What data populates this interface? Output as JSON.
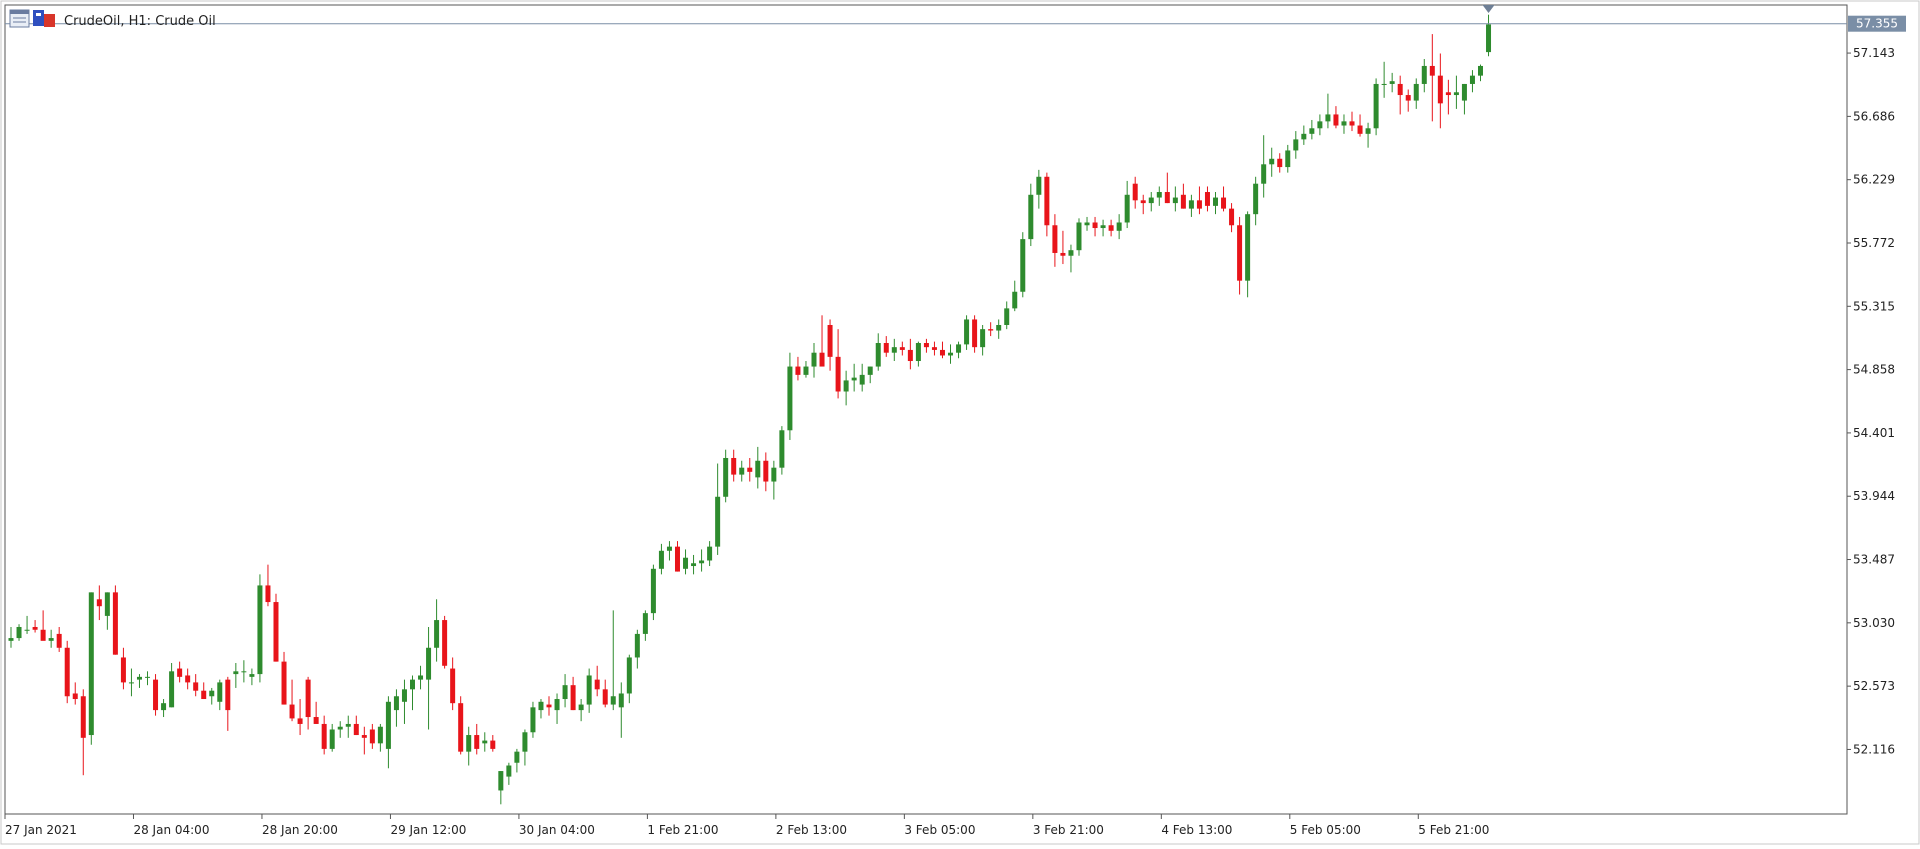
{
  "header": {
    "symbol_label": "CrudeOil, H1:  Crude Oil",
    "icon_names": [
      "chart-window-icon",
      "symbol-flag-icon"
    ]
  },
  "current_price": "57.355",
  "colors": {
    "bull": "#2e8b2e",
    "bear": "#e8141a",
    "axis": "#555555",
    "price_tag_bg": "#7a8ea6",
    "price_line": "#7a8ea6"
  },
  "chart_data": {
    "type": "candlestick",
    "title": "CrudeOil, H1:  Crude Oil",
    "xlabel": "",
    "ylabel": "",
    "ylim": [
      51.65,
      57.49
    ],
    "y_ticks": [
      57.143,
      56.686,
      56.229,
      55.772,
      55.315,
      54.858,
      54.401,
      53.944,
      53.487,
      53.03,
      52.573,
      52.116
    ],
    "y_tick_labels": [
      "57.143",
      "56.686",
      "56.229",
      "55.772",
      "55.315",
      "54.858",
      "54.401",
      "53.944",
      "53.487",
      "53.030",
      "52.573",
      "52.116"
    ],
    "x_ticks": [
      {
        "bar": 0,
        "label": "27 Jan 2021"
      },
      {
        "bar": 16,
        "label": "28 Jan 04:00"
      },
      {
        "bar": 32,
        "label": "28 Jan 20:00"
      },
      {
        "bar": 48,
        "label": "29 Jan 12:00"
      },
      {
        "bar": 64,
        "label": "30 Jan 04:00"
      },
      {
        "bar": 80,
        "label": "1 Feb 21:00"
      },
      {
        "bar": 96,
        "label": "2 Feb 13:00"
      },
      {
        "bar": 112,
        "label": "3 Feb 05:00"
      },
      {
        "bar": 128,
        "label": "3 Feb 21:00"
      },
      {
        "bar": 144,
        "label": "4 Feb 13:00"
      },
      {
        "bar": 160,
        "label": "5 Feb 05:00"
      },
      {
        "bar": 176,
        "label": "5 Feb 21:00"
      }
    ],
    "grid": false,
    "candles": [
      [
        52.9,
        53.0,
        52.85,
        52.92
      ],
      [
        52.92,
        53.02,
        52.9,
        53.0
      ],
      [
        52.98,
        53.08,
        52.95,
        52.98
      ],
      [
        53.0,
        53.05,
        52.96,
        52.98
      ],
      [
        52.98,
        53.12,
        52.92,
        52.9
      ],
      [
        52.9,
        52.98,
        52.85,
        52.92
      ],
      [
        52.95,
        53.0,
        52.82,
        52.85
      ],
      [
        52.85,
        52.9,
        52.45,
        52.5
      ],
      [
        52.52,
        52.6,
        52.44,
        52.48
      ],
      [
        52.5,
        52.55,
        51.93,
        52.2
      ],
      [
        52.22,
        53.25,
        52.15,
        53.25
      ],
      [
        53.2,
        53.3,
        53.05,
        53.15
      ],
      [
        53.08,
        53.25,
        52.98,
        53.25
      ],
      [
        53.25,
        53.3,
        52.8,
        52.8
      ],
      [
        52.78,
        52.85,
        52.55,
        52.6
      ],
      [
        52.6,
        52.7,
        52.5,
        52.6
      ],
      [
        52.62,
        52.66,
        52.56,
        52.64
      ],
      [
        52.64,
        52.68,
        52.58,
        52.64
      ],
      [
        52.62,
        52.66,
        52.36,
        52.4
      ],
      [
        52.4,
        52.48,
        52.35,
        52.45
      ],
      [
        52.42,
        52.74,
        52.42,
        52.68
      ],
      [
        52.7,
        52.75,
        52.6,
        52.64
      ],
      [
        52.65,
        52.7,
        52.55,
        52.6
      ],
      [
        52.6,
        52.66,
        52.5,
        52.54
      ],
      [
        52.54,
        52.6,
        52.48,
        52.48
      ],
      [
        52.5,
        52.56,
        52.44,
        52.54
      ],
      [
        52.46,
        52.62,
        52.4,
        52.6
      ],
      [
        52.62,
        52.64,
        52.25,
        52.4
      ],
      [
        52.66,
        52.74,
        52.56,
        52.68
      ],
      [
        52.68,
        52.76,
        52.6,
        52.68
      ],
      [
        52.64,
        52.7,
        52.58,
        52.66
      ],
      [
        52.66,
        53.38,
        52.6,
        53.3
      ],
      [
        53.3,
        53.45,
        53.15,
        53.18
      ],
      [
        53.18,
        53.24,
        52.75,
        52.75
      ],
      [
        52.75,
        52.82,
        52.44,
        52.44
      ],
      [
        52.44,
        52.62,
        52.32,
        52.34
      ],
      [
        52.34,
        52.48,
        52.22,
        52.3
      ],
      [
        52.62,
        52.64,
        52.26,
        52.35
      ],
      [
        52.35,
        52.46,
        52.3,
        52.3
      ],
      [
        52.3,
        52.36,
        52.08,
        52.12
      ],
      [
        52.12,
        52.3,
        52.1,
        52.26
      ],
      [
        52.26,
        52.32,
        52.2,
        52.28
      ],
      [
        52.28,
        52.36,
        52.2,
        52.3
      ],
      [
        52.3,
        52.36,
        52.22,
        52.22
      ],
      [
        52.22,
        52.28,
        52.08,
        52.2
      ],
      [
        52.26,
        52.3,
        52.12,
        52.16
      ],
      [
        52.16,
        52.3,
        52.1,
        52.28
      ],
      [
        52.12,
        52.5,
        51.98,
        52.46
      ],
      [
        52.4,
        52.55,
        52.28,
        52.5
      ],
      [
        52.46,
        52.62,
        52.3,
        52.55
      ],
      [
        52.55,
        52.65,
        52.4,
        52.62
      ],
      [
        52.62,
        52.72,
        52.55,
        52.65
      ],
      [
        52.62,
        53.0,
        52.26,
        52.85
      ],
      [
        52.85,
        53.2,
        52.75,
        53.05
      ],
      [
        53.05,
        53.08,
        52.7,
        52.72
      ],
      [
        52.7,
        52.78,
        52.4,
        52.45
      ],
      [
        52.45,
        52.5,
        52.08,
        52.1
      ],
      [
        52.1,
        52.28,
        52.0,
        52.22
      ],
      [
        52.22,
        52.3,
        52.08,
        52.12
      ],
      [
        52.16,
        52.24,
        52.1,
        52.18
      ],
      [
        52.18,
        52.22,
        52.1,
        52.12
      ],
      [
        51.82,
        51.96,
        51.72,
        51.96
      ],
      [
        51.92,
        52.02,
        51.86,
        52.0
      ],
      [
        52.02,
        52.12,
        51.95,
        52.1
      ],
      [
        52.1,
        52.26,
        52.0,
        52.24
      ],
      [
        52.24,
        52.46,
        52.2,
        52.42
      ],
      [
        52.4,
        52.48,
        52.34,
        52.46
      ],
      [
        52.44,
        52.5,
        52.36,
        52.42
      ],
      [
        52.4,
        52.52,
        52.3,
        52.48
      ],
      [
        52.48,
        52.66,
        52.42,
        52.58
      ],
      [
        52.58,
        52.64,
        52.4,
        52.4
      ],
      [
        52.4,
        52.48,
        52.32,
        52.44
      ],
      [
        52.44,
        52.7,
        52.38,
        52.65
      ],
      [
        52.62,
        52.72,
        52.5,
        52.55
      ],
      [
        52.55,
        52.62,
        52.42,
        52.44
      ],
      [
        52.44,
        53.12,
        52.4,
        52.5
      ],
      [
        52.42,
        52.6,
        52.2,
        52.52
      ],
      [
        52.52,
        52.8,
        52.45,
        52.78
      ],
      [
        52.78,
        52.98,
        52.7,
        52.95
      ],
      [
        52.95,
        53.12,
        52.9,
        53.1
      ],
      [
        53.1,
        53.45,
        53.05,
        53.42
      ],
      [
        53.42,
        53.6,
        53.38,
        53.55
      ],
      [
        53.55,
        53.62,
        53.48,
        53.58
      ],
      [
        53.58,
        53.62,
        53.4,
        53.4
      ],
      [
        53.42,
        53.56,
        53.38,
        53.5
      ],
      [
        53.44,
        53.52,
        53.38,
        53.46
      ],
      [
        53.46,
        53.56,
        53.4,
        53.48
      ],
      [
        53.48,
        53.62,
        53.44,
        53.58
      ],
      [
        53.58,
        54.18,
        53.52,
        53.94
      ],
      [
        53.94,
        54.28,
        53.9,
        54.22
      ],
      [
        54.22,
        54.28,
        54.05,
        54.1
      ],
      [
        54.1,
        54.2,
        54.05,
        54.15
      ],
      [
        54.15,
        54.22,
        54.05,
        54.12
      ],
      [
        54.08,
        54.3,
        54.0,
        54.2
      ],
      [
        54.2,
        54.26,
        53.98,
        54.05
      ],
      [
        54.05,
        54.2,
        53.92,
        54.15
      ],
      [
        54.15,
        54.45,
        54.1,
        54.42
      ],
      [
        54.42,
        54.98,
        54.35,
        54.88
      ],
      [
        54.88,
        54.95,
        54.78,
        54.82
      ],
      [
        54.82,
        54.92,
        54.8,
        54.88
      ],
      [
        54.88,
        55.05,
        54.8,
        54.98
      ],
      [
        54.98,
        55.25,
        54.92,
        54.88
      ],
      [
        55.18,
        55.22,
        54.85,
        54.95
      ],
      [
        54.95,
        55.15,
        54.65,
        54.7
      ],
      [
        54.7,
        54.85,
        54.6,
        54.78
      ],
      [
        54.78,
        54.9,
        54.7,
        54.8
      ],
      [
        54.75,
        54.9,
        54.7,
        54.82
      ],
      [
        54.82,
        54.88,
        54.76,
        54.88
      ],
      [
        54.88,
        55.12,
        54.85,
        55.05
      ],
      [
        55.05,
        55.1,
        54.95,
        54.98
      ],
      [
        54.98,
        55.08,
        54.92,
        55.02
      ],
      [
        55.02,
        55.06,
        54.96,
        55.0
      ],
      [
        55.0,
        55.08,
        54.86,
        54.92
      ],
      [
        54.92,
        55.06,
        54.88,
        55.05
      ],
      [
        55.05,
        55.08,
        54.98,
        55.02
      ],
      [
        55.02,
        55.06,
        54.96,
        55.0
      ],
      [
        55.0,
        55.06,
        54.94,
        54.96
      ],
      [
        54.96,
        55.04,
        54.9,
        54.98
      ],
      [
        54.98,
        55.06,
        54.94,
        55.04
      ],
      [
        55.04,
        55.25,
        55.0,
        55.22
      ],
      [
        55.22,
        55.25,
        54.98,
        55.02
      ],
      [
        55.02,
        55.18,
        54.96,
        55.15
      ],
      [
        55.15,
        55.2,
        55.1,
        55.14
      ],
      [
        55.14,
        55.22,
        55.08,
        55.18
      ],
      [
        55.18,
        55.35,
        55.15,
        55.3
      ],
      [
        55.3,
        55.5,
        55.28,
        55.42
      ],
      [
        55.42,
        55.85,
        55.38,
        55.8
      ],
      [
        55.8,
        56.2,
        55.75,
        56.12
      ],
      [
        56.12,
        56.3,
        56.02,
        56.25
      ],
      [
        56.25,
        56.28,
        55.82,
        55.9
      ],
      [
        55.9,
        55.98,
        55.6,
        55.7
      ],
      [
        55.7,
        55.86,
        55.62,
        55.68
      ],
      [
        55.68,
        55.76,
        55.56,
        55.72
      ],
      [
        55.72,
        55.95,
        55.68,
        55.92
      ],
      [
        55.9,
        55.96,
        55.86,
        55.92
      ],
      [
        55.92,
        55.96,
        55.82,
        55.88
      ],
      [
        55.88,
        55.94,
        55.82,
        55.9
      ],
      [
        55.9,
        55.94,
        55.82,
        55.86
      ],
      [
        55.86,
        55.98,
        55.8,
        55.92
      ],
      [
        55.92,
        56.22,
        55.88,
        56.12
      ],
      [
        56.2,
        56.25,
        56.02,
        56.08
      ],
      [
        56.08,
        56.12,
        55.98,
        56.06
      ],
      [
        56.06,
        56.14,
        56.0,
        56.1
      ],
      [
        56.1,
        56.18,
        56.04,
        56.14
      ],
      [
        56.14,
        56.28,
        56.06,
        56.06
      ],
      [
        56.06,
        56.18,
        56.0,
        56.1
      ],
      [
        56.12,
        56.2,
        56.02,
        56.02
      ],
      [
        56.02,
        56.12,
        55.96,
        56.08
      ],
      [
        56.08,
        56.18,
        55.98,
        56.02
      ],
      [
        56.14,
        56.18,
        56.0,
        56.04
      ],
      [
        56.04,
        56.14,
        55.98,
        56.1
      ],
      [
        56.1,
        56.18,
        56.0,
        56.02
      ],
      [
        56.02,
        56.06,
        55.85,
        55.9
      ],
      [
        55.9,
        55.96,
        55.4,
        55.5
      ],
      [
        55.5,
        56.0,
        55.38,
        55.98
      ],
      [
        55.98,
        56.25,
        55.9,
        56.2
      ],
      [
        56.2,
        56.55,
        56.1,
        56.34
      ],
      [
        56.34,
        56.46,
        56.25,
        56.38
      ],
      [
        56.38,
        56.42,
        56.28,
        56.32
      ],
      [
        56.32,
        56.48,
        56.28,
        56.44
      ],
      [
        56.44,
        56.58,
        56.38,
        56.52
      ],
      [
        56.52,
        56.62,
        56.48,
        56.56
      ],
      [
        56.56,
        56.66,
        56.52,
        56.6
      ],
      [
        56.6,
        56.7,
        56.55,
        56.65
      ],
      [
        56.65,
        56.85,
        56.6,
        56.7
      ],
      [
        56.7,
        56.76,
        56.6,
        56.62
      ],
      [
        56.62,
        56.7,
        56.56,
        56.65
      ],
      [
        56.65,
        56.72,
        56.58,
        56.62
      ],
      [
        56.62,
        56.7,
        56.54,
        56.56
      ],
      [
        56.56,
        56.64,
        56.46,
        56.6
      ],
      [
        56.6,
        56.96,
        56.55,
        56.92
      ],
      [
        56.92,
        57.08,
        56.82,
        56.92
      ],
      [
        56.92,
        57.0,
        56.86,
        56.94
      ],
      [
        56.92,
        56.98,
        56.7,
        56.84
      ],
      [
        56.84,
        56.88,
        56.72,
        56.8
      ],
      [
        56.8,
        56.96,
        56.74,
        56.92
      ],
      [
        56.92,
        57.1,
        56.86,
        57.05
      ],
      [
        57.05,
        57.28,
        56.65,
        56.98
      ],
      [
        56.98,
        57.14,
        56.6,
        56.78
      ],
      [
        56.86,
        56.95,
        56.7,
        56.84
      ],
      [
        56.84,
        56.98,
        56.74,
        56.86
      ],
      [
        56.8,
        56.92,
        56.7,
        56.92
      ],
      [
        56.92,
        57.02,
        56.86,
        56.98
      ],
      [
        56.98,
        57.06,
        56.94,
        57.05
      ],
      [
        57.15,
        57.42,
        57.12,
        57.35
      ]
    ]
  }
}
